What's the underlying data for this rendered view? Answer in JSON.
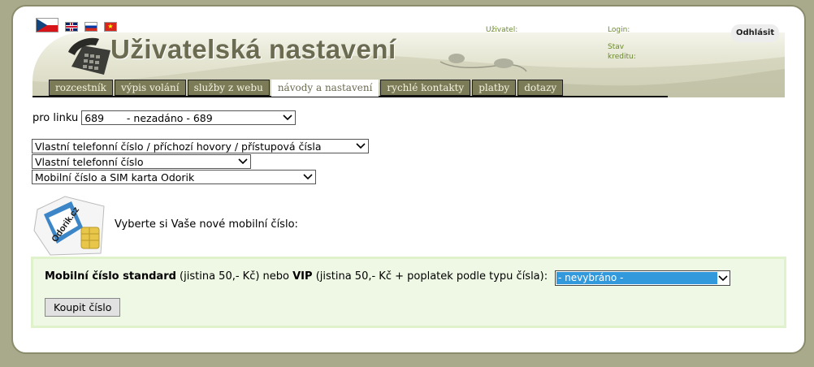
{
  "header": {
    "title": "Uživatelská nastavení",
    "user_label": "Uživatel:",
    "login_label": "Login:",
    "credit_label": "Stav kreditu:",
    "logout_label": "Odhlásit",
    "flags": [
      "czech-flag",
      "uk-flag",
      "russia-flag",
      "vietnam-flag"
    ]
  },
  "tabs": [
    {
      "label": "rozcestník",
      "active": false
    },
    {
      "label": "výpis volání",
      "active": false
    },
    {
      "label": "služby z webu",
      "active": false
    },
    {
      "label": "návody a nastavení",
      "active": true
    },
    {
      "label": "rychlé kontakty",
      "active": false
    },
    {
      "label": "platby",
      "active": false
    },
    {
      "label": "dotazy",
      "active": false
    }
  ],
  "line": {
    "label": "pro linku",
    "value": "689       - nezadáno - 689"
  },
  "categories": {
    "level1": "Vlastní telefonní číslo / příchozí hovory / přístupová čísla",
    "level2": "Vlastní telefonní číslo",
    "level3": "Mobilní číslo a SIM karta Odorik"
  },
  "sim": {
    "logo_text": "Odorik.cz",
    "prompt": "Vyberte si Vaše nové mobilní číslo:"
  },
  "purchase": {
    "standard_bold": "Mobilní číslo standard",
    "standard_text": " (jistina 50,- Kč) nebo ",
    "vip_bold": "VIP",
    "vip_text": " (jistina 50,- Kč + poplatek podle typu čísla): ",
    "select_value": "- nevybráno -",
    "buy_label": "Koupit číslo"
  },
  "colors": {
    "background": "#a9aa8c",
    "tab_bg": "#7b7b57",
    "title": "#6b6b52",
    "panel_bg": "#eef8e4",
    "selected_option": "#3399dd"
  }
}
